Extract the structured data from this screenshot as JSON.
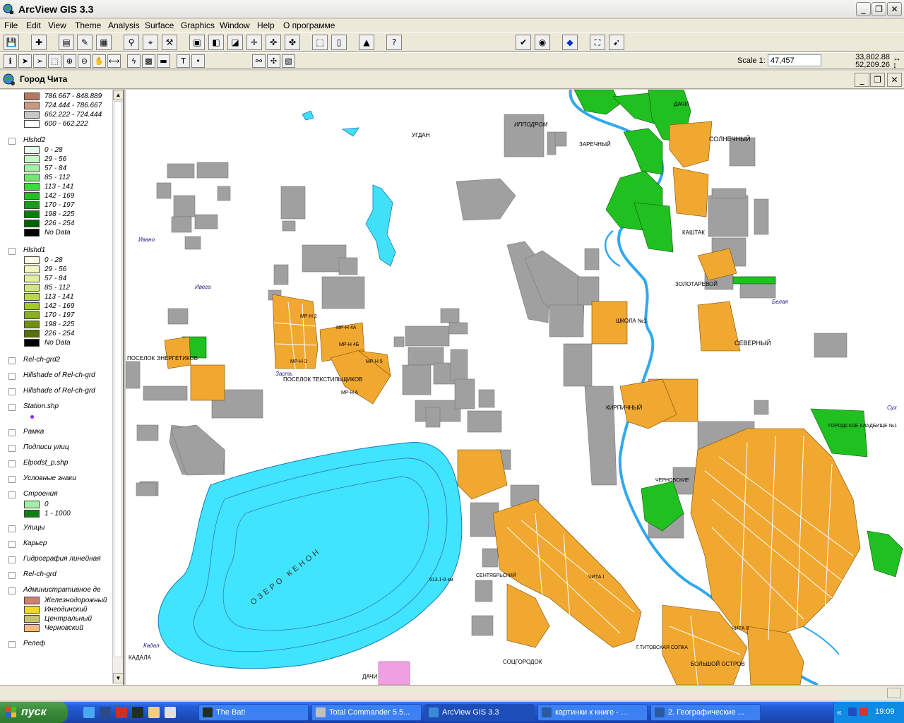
{
  "window": {
    "title": "ArcView GIS 3.3"
  },
  "menu": [
    "File",
    "Edit",
    "View",
    "Theme",
    "Analysis",
    "Surface",
    "Graphics",
    "Window",
    "Help",
    "О программе"
  ],
  "scale": {
    "label": "Scale 1:",
    "value": "47,457"
  },
  "coords": {
    "x": "33,802.88",
    "y": "52,209.26"
  },
  "view": {
    "title": "Город Чита"
  },
  "toc": {
    "top_classes": [
      {
        "label": "786.667 - 848.889",
        "color": "#b87860"
      },
      {
        "label": "724.444 - 786.667",
        "color": "#c89880"
      },
      {
        "label": "662.222 - 724.444",
        "color": "#c8c8c8"
      },
      {
        "label": "600 - 662.222",
        "color": "#ffffff"
      }
    ],
    "hlshd2": {
      "name": "Hlshd2",
      "classes": [
        {
          "label": "0 - 28",
          "color": "#e8fce8"
        },
        {
          "label": "29 - 56",
          "color": "#c8f8c8"
        },
        {
          "label": "57 - 84",
          "color": "#a0f0a0"
        },
        {
          "label": "85 - 112",
          "color": "#70e870"
        },
        {
          "label": "113 - 141",
          "color": "#40d840"
        },
        {
          "label": "142 - 169",
          "color": "#20c020"
        },
        {
          "label": "170 - 197",
          "color": "#10a010"
        },
        {
          "label": "198 - 225",
          "color": "#088008"
        },
        {
          "label": "226 - 254",
          "color": "#046004"
        },
        {
          "label": "No Data",
          "color": "#000000"
        }
      ]
    },
    "hlshd1": {
      "name": "Hlshd1",
      "classes": [
        {
          "label": "0 - 28",
          "color": "#fcfce0"
        },
        {
          "label": "29 - 56",
          "color": "#f0f8c0"
        },
        {
          "label": "57 - 84",
          "color": "#e0f0a0"
        },
        {
          "label": "85 - 112",
          "color": "#d0e880"
        },
        {
          "label": "113 - 141",
          "color": "#b8d850"
        },
        {
          "label": "142 - 169",
          "color": "#a0c830"
        },
        {
          "label": "170 - 197",
          "color": "#88b020"
        },
        {
          "label": "198 - 225",
          "color": "#709010"
        },
        {
          "label": "226 - 254",
          "color": "#587008"
        },
        {
          "label": "No Data",
          "color": "#000000"
        }
      ]
    },
    "themes": [
      "Rel-ch-grd2",
      "Hillshade of Rel-ch-grd",
      "Hillshade of Rel-ch-grd",
      "Station.shp",
      "Рамка",
      "Подписи улиц",
      "Elpodst_p.shp",
      "Условные знаки",
      "Строения",
      "Улицы",
      "Карьер",
      "Гидрография линейная",
      "Rel-ch-grd",
      "Административное де",
      "Релеф"
    ],
    "stroenia_classes": [
      {
        "label": "0",
        "color": "#a0f0a0"
      },
      {
        "label": "1 - 1000",
        "color": "#108010"
      }
    ],
    "admin_classes": [
      {
        "label": "Железнодорожный",
        "color": "#d08070"
      },
      {
        "label": "Ингодинский",
        "color": "#f8d820"
      },
      {
        "label": "Центральный",
        "color": "#c8c070"
      },
      {
        "label": "Черновский",
        "color": "#f8b880"
      }
    ]
  },
  "map_labels": [
    "ДАЧИ",
    "СОЛНЕЧНЫЙ",
    "ЗАРЕЧНЫЙ",
    "ИППОДРОМ",
    "УГДАН",
    "КАШТАК",
    "ЗОЛОТАРЕВОЙ",
    "СЕВЕРНЫЙ",
    "ШКОЛА №1",
    "КИРПИЧНЫЙ",
    "МР-Н 2",
    "МР-Н 4А",
    "МР-Н 4Б",
    "МР-Н 3",
    "МР-Н 5",
    "МР-Н 6",
    "ПОСЕЛОК ТЕКСТИЛЬЩИКОВ",
    "ПОСЕЛОК ЭНЕРГЕТИКОВ",
    "ОЗЕРО КЕНОН",
    "КАДАЛА",
    "СОЦГОРОДОК",
    "БОЛЬШОЙ ОСТРОВ",
    "ЧИТА I",
    "ЧИТА II",
    "ГОРОДСКОЕ КЛАДБИЩЕ №1",
    "ДАЧИ",
    "Ивано",
    "Ивега",
    "Засть",
    "Кадал",
    "Сух",
    "Белая",
    "613.1-й км",
    "СЕНТЯБРЬСКИЙ",
    "Г.ТИТОВСКАЯ СОПКА",
    "ЧЕРНОВСКИЕ"
  ],
  "taskbar": {
    "start": "пуск",
    "tasks": [
      "The Bat!",
      "Total Commander 5.5...",
      "ArcView GIS 3.3",
      "картинки к книге - ...",
      "2. Географические ..."
    ],
    "clock": "19:09"
  }
}
